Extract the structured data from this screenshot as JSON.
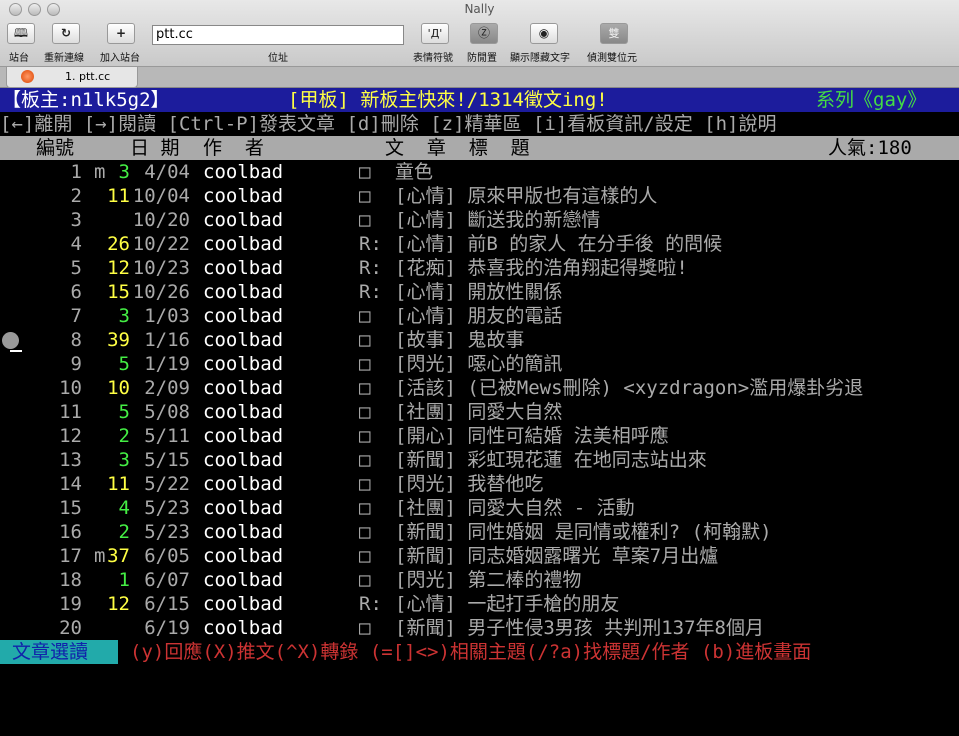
{
  "window": {
    "title": "Nally"
  },
  "toolbar": {
    "sites": "站台",
    "reconnect": "重新連線",
    "add_site": "加入站台",
    "address_label": "位址",
    "address_value": "ptt.cc",
    "emoticons": "表情符號",
    "anti_idle": "防閒置",
    "show_hidden": "顯示隱藏文字",
    "detect_dbcs": "偵測雙位元",
    "emoticon_glyph": "'Д'",
    "dbcs_glyph": "雙"
  },
  "tabs": [
    {
      "label": "1. ptt.cc"
    }
  ],
  "terminal": {
    "header": {
      "moderator": "【板主:n1lk5g2】",
      "board_title": "[甲板] 新板主快來!/1314徵文ing!",
      "series": "系列《gay》"
    },
    "help": "[←]離開 [→]閱讀 [Ctrl-P]發表文章 [d]刪除 [z]精華區 [i]看板資訊/設定 [h]說明",
    "columns": {
      "num": "編號",
      "date": "日 期",
      "author": "作  者",
      "title": "文  章  標  題",
      "popularity": "人氣:180"
    },
    "rows": [
      {
        "num": "1",
        "mark": "m",
        "push": "3",
        "push_color": "green",
        "date": "4/04",
        "author": "coolbad",
        "flag": "□",
        "title": "童色"
      },
      {
        "num": "2",
        "mark": "",
        "push": "11",
        "push_color": "yellow",
        "date": "10/04",
        "author": "coolbad",
        "flag": "□",
        "title": "[心情] 原來甲版也有這樣的人"
      },
      {
        "num": "3",
        "mark": "",
        "push": "",
        "push_color": "",
        "date": "10/20",
        "author": "coolbad",
        "flag": "□",
        "title": "[心情] 斷送我的新戀情"
      },
      {
        "num": "4",
        "mark": "",
        "push": "26",
        "push_color": "yellow",
        "date": "10/22",
        "author": "coolbad",
        "flag": "R:",
        "title": "[心情] 前B 的家人 在分手後 的問候"
      },
      {
        "num": "5",
        "mark": "",
        "push": "12",
        "push_color": "yellow",
        "date": "10/23",
        "author": "coolbad",
        "flag": "R:",
        "title": "[花痴] 恭喜我的浩角翔起得獎啦!"
      },
      {
        "num": "6",
        "mark": "",
        "push": "15",
        "push_color": "yellow",
        "date": "10/26",
        "author": "coolbad",
        "flag": "R:",
        "title": "[心情] 開放性關係"
      },
      {
        "num": "7",
        "mark": "",
        "push": "3",
        "push_color": "green",
        "date": "1/03",
        "author": "coolbad",
        "flag": "□",
        "title": "[心情] 朋友的電話"
      },
      {
        "num": "8",
        "mark": "",
        "push": "39",
        "push_color": "yellow",
        "date": "1/16",
        "author": "coolbad",
        "flag": "□",
        "title": "[故事] 鬼故事"
      },
      {
        "num": "9",
        "mark": "",
        "push": "5",
        "push_color": "green",
        "date": "1/19",
        "author": "coolbad",
        "flag": "□",
        "title": "[閃光] 噁心的簡訊"
      },
      {
        "num": "10",
        "mark": "",
        "push": "10",
        "push_color": "yellow",
        "date": "2/09",
        "author": "coolbad",
        "flag": "□",
        "title": "[活該] (已被Mews刪除) <xyzdragon>濫用爆卦劣退"
      },
      {
        "num": "11",
        "mark": "",
        "push": "5",
        "push_color": "green",
        "date": "5/08",
        "author": "coolbad",
        "flag": "□",
        "title": "[社團] 同愛大自然"
      },
      {
        "num": "12",
        "mark": "",
        "push": "2",
        "push_color": "green",
        "date": "5/11",
        "author": "coolbad",
        "flag": "□",
        "title": "[開心] 同性可結婚 法美相呼應"
      },
      {
        "num": "13",
        "mark": "",
        "push": "3",
        "push_color": "green",
        "date": "5/15",
        "author": "coolbad",
        "flag": "□",
        "title": "[新聞] 彩虹現花蓮 在地同志站出來"
      },
      {
        "num": "14",
        "mark": "",
        "push": "11",
        "push_color": "yellow",
        "date": "5/22",
        "author": "coolbad",
        "flag": "□",
        "title": "[閃光] 我替他吃"
      },
      {
        "num": "15",
        "mark": "",
        "push": "4",
        "push_color": "green",
        "date": "5/23",
        "author": "coolbad",
        "flag": "□",
        "title": "[社團] 同愛大自然 - 活動"
      },
      {
        "num": "16",
        "mark": "",
        "push": "2",
        "push_color": "green",
        "date": "5/23",
        "author": "coolbad",
        "flag": "□",
        "title": "[新聞] 同性婚姻 是同情或權利? (柯翰默)"
      },
      {
        "num": "17",
        "mark": "m",
        "push": "37",
        "push_color": "yellow",
        "date": "6/05",
        "author": "coolbad",
        "flag": "□",
        "title": "[新聞] 同志婚姻露曙光 草案7月出爐"
      },
      {
        "num": "18",
        "mark": "",
        "push": "1",
        "push_color": "green",
        "date": "6/07",
        "author": "coolbad",
        "flag": "□",
        "title": "[閃光] 第二棒的禮物"
      },
      {
        "num": "19",
        "mark": "",
        "push": "12",
        "push_color": "yellow",
        "date": "6/15",
        "author": "coolbad",
        "flag": "R:",
        "title": "[心情] 一起打手槍的朋友"
      },
      {
        "num": "20",
        "mark": "",
        "push": "",
        "push_color": "",
        "date": "6/19",
        "author": "coolbad",
        "flag": "□",
        "title": "[新聞] 男子性侵3男孩 共判刑137年8個月"
      }
    ],
    "footer": {
      "mode": "文章選讀",
      "help": "(y)回應(X)推文(^X)轉錄 (=[]<>)相關主題(/?a)找標題/作者 (b)進板畫面"
    }
  },
  "colors": {
    "header_bg": "#1c1c9c",
    "header_yellow": "#ffff44",
    "header_green": "#44dd44",
    "column_bar_bg": "#aaaaaa",
    "footer_mode_bg": "#22aaaa",
    "footer_text": "#cc3333"
  }
}
